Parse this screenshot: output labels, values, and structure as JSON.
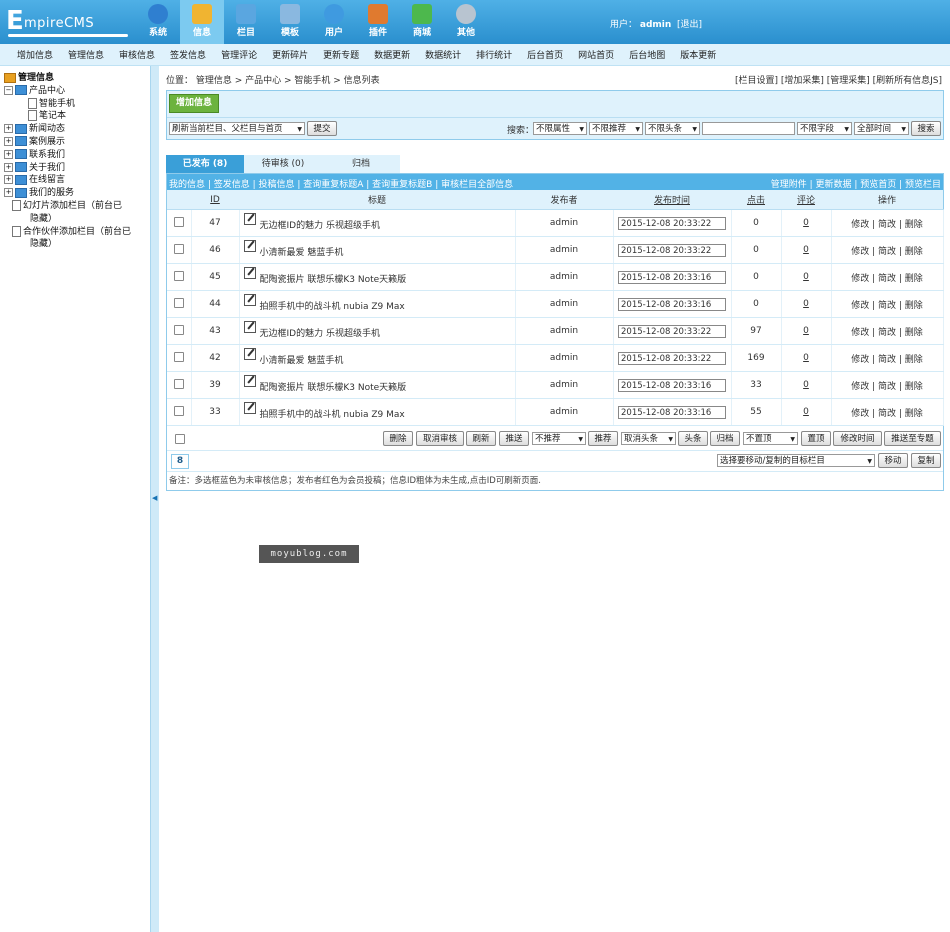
{
  "logo": {
    "big": "E",
    "small": "mpireCMS"
  },
  "nav": [
    {
      "label": "系统",
      "icon": "globe-icon",
      "color": "#2f7fd0"
    },
    {
      "label": "信息",
      "icon": "notepad-pencil-icon",
      "color": "#f0b431",
      "active": true
    },
    {
      "label": "栏目",
      "icon": "folder-icon",
      "color": "#5aa6e0"
    },
    {
      "label": "模板",
      "icon": "window-template-icon",
      "color": "#8ab8e0"
    },
    {
      "label": "用户",
      "icon": "user-icon",
      "color": "#3f9ae0"
    },
    {
      "label": "插件",
      "icon": "tools-icon",
      "color": "#e07a2f"
    },
    {
      "label": "商城",
      "icon": "monitor-icon",
      "color": "#4db84d"
    },
    {
      "label": "其他",
      "icon": "gear-icon",
      "color": "#b8c4d0"
    }
  ],
  "user": {
    "prefix": "用户：",
    "name": "admin",
    "logout": "[退出]"
  },
  "subnav": [
    "增加信息",
    "管理信息",
    "审核信息",
    "签发信息",
    "管理评论",
    "更新碎片",
    "更新专题",
    "数据更新",
    "数据统计",
    "排行统计",
    "后台首页",
    "网站首页",
    "后台地图",
    "版本更新"
  ],
  "tree": {
    "root": "管理信息",
    "items": [
      {
        "label": "产品中心",
        "level": 0,
        "type": "folder-open"
      },
      {
        "label": "智能手机",
        "level": 1,
        "type": "page"
      },
      {
        "label": "笔记本",
        "level": 1,
        "type": "page"
      },
      {
        "label": "新闻动态",
        "level": 0,
        "type": "folder"
      },
      {
        "label": "案例展示",
        "level": 0,
        "type": "folder"
      },
      {
        "label": "联系我们",
        "level": 0,
        "type": "folder"
      },
      {
        "label": "关于我们",
        "level": 0,
        "type": "folder"
      },
      {
        "label": "在线留言",
        "level": 0,
        "type": "folder"
      },
      {
        "label": "我们的服务",
        "level": 0,
        "type": "folder"
      },
      {
        "label": "幻灯片添加栏目（前台已",
        "label2": "隐藏）",
        "level": 0,
        "type": "page-line"
      },
      {
        "label": "合作伙伴添加栏目（前台已",
        "label2": "隐藏）",
        "level": 0,
        "type": "page-line"
      }
    ]
  },
  "breadcrumb": {
    "left": "位置：  管理信息 > 产品中心 > 智能手机 > 信息列表",
    "right": "[栏目设置] [增加采集] [管理采集] [刷新所有信息JS]"
  },
  "toolbox": {
    "add_label": "增加信息",
    "refresh_select": "刷新当前栏目、父栏目与首页",
    "submit_label": "提交",
    "search_label": "搜索：",
    "filters": [
      "不限属性",
      "不限推荐",
      "不限头条"
    ],
    "field_select": "不限字段",
    "time_select": "全部时间",
    "search_btn": "搜索"
  },
  "tabs": [
    {
      "label": "已发布 (8)",
      "active": true
    },
    {
      "label": "待审核 (0)",
      "active": false
    },
    {
      "label": "归档",
      "active": false
    }
  ],
  "linkbar": {
    "left": "我的信息 | 签发信息 | 投稿信息 | 查询重复标题A | 查询重复标题B | 审核栏目全部信息",
    "right": "管理附件 | 更新数据 | 预览首页 | 预览栏目"
  },
  "columns": {
    "id": "ID",
    "title": "标题",
    "author": "发布者",
    "time": "发布时间",
    "clicks": "点击",
    "comments": "评论",
    "actions": "操作"
  },
  "rows": [
    {
      "id": "47",
      "title": "无边框ID的魅力 乐视超级手机",
      "author": "admin",
      "time": "2015-12-08 20:33:22",
      "clicks": "0",
      "comments": "0"
    },
    {
      "id": "46",
      "title": "小清新最爱 魅蓝手机",
      "author": "admin",
      "time": "2015-12-08 20:33:22",
      "clicks": "0",
      "comments": "0"
    },
    {
      "id": "45",
      "title": "配陶瓷振片 联想乐檬K3 Note天籁版",
      "author": "admin",
      "time": "2015-12-08 20:33:16",
      "clicks": "0",
      "comments": "0"
    },
    {
      "id": "44",
      "title": "拍照手机中的战斗机 nubia Z9 Max",
      "author": "admin",
      "time": "2015-12-08 20:33:16",
      "clicks": "0",
      "comments": "0"
    },
    {
      "id": "43",
      "title": "无边框ID的魅力 乐视超级手机",
      "author": "admin",
      "time": "2015-12-08 20:33:22",
      "clicks": "97",
      "comments": "0"
    },
    {
      "id": "42",
      "title": "小清新最爱 魅蓝手机",
      "author": "admin",
      "time": "2015-12-08 20:33:22",
      "clicks": "169",
      "comments": "0"
    },
    {
      "id": "39",
      "title": "配陶瓷振片 联想乐檬K3 Note天籁版",
      "author": "admin",
      "time": "2015-12-08 20:33:16",
      "clicks": "33",
      "comments": "0"
    },
    {
      "id": "33",
      "title": "拍照手机中的战斗机 nubia Z9 Max",
      "author": "admin",
      "time": "2015-12-08 20:33:16",
      "clicks": "55",
      "comments": "0"
    }
  ],
  "row_actions": {
    "edit": "修改",
    "simple": "简改",
    "delete": "删除"
  },
  "bulk": {
    "delete": "删除",
    "unaudit": "取消审核",
    "refresh": "刷新",
    "push": "推送",
    "recommend_select": "不推荐",
    "recommend": "推荐",
    "headline_select": "取消头条",
    "headline": "头条",
    "archive": "归档",
    "top_select": "不置顶",
    "top": "置顶",
    "edit_time": "修改时间",
    "push_topic": "推送至专题"
  },
  "footer": {
    "count": "8",
    "move_select": "选择要移动/复制的目标栏目",
    "move": "移动",
    "copy": "复制"
  },
  "note": "备注：多选框蓝色为未审核信息；发布者红色为会员投稿；信息ID粗体为未生成,点击ID可刷新页面.",
  "watermark": "moyublog.com"
}
